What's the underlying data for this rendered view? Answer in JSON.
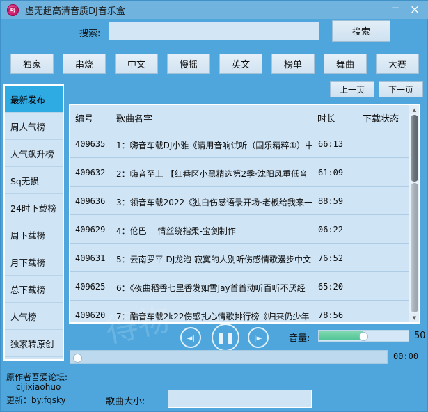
{
  "window": {
    "title": "虚无超高清音质DJ音乐盒",
    "icon": "dj-headphone-icon",
    "icon_text": "DJ",
    "minimize": "−",
    "close": "×"
  },
  "search": {
    "label": "搜索:",
    "value": "",
    "placeholder": "",
    "button": "搜索"
  },
  "categories": [
    {
      "label": "独家"
    },
    {
      "label": "串烧"
    },
    {
      "label": "中文"
    },
    {
      "label": "慢摇"
    },
    {
      "label": "英文"
    },
    {
      "label": "榜单"
    },
    {
      "label": "舞曲"
    },
    {
      "label": "大赛"
    }
  ],
  "pagination": {
    "prev": "上一页",
    "next": "下一页"
  },
  "sidebar": {
    "items": [
      {
        "label": "最新发布",
        "active": true
      },
      {
        "label": "周人气榜",
        "active": false
      },
      {
        "label": "人气飙升榜",
        "active": false
      },
      {
        "label": "Sq无损",
        "active": false
      },
      {
        "label": "24时下载榜",
        "active": false
      },
      {
        "label": "周下载榜",
        "active": false
      },
      {
        "label": "月下载榜",
        "active": false
      },
      {
        "label": "总下载榜",
        "active": false
      },
      {
        "label": "人气榜",
        "active": false
      },
      {
        "label": "独家转原创",
        "active": false
      }
    ]
  },
  "list": {
    "headers": {
      "id": "编号",
      "name": "歌曲名字",
      "duration": "时长",
      "status": "下载状态"
    },
    "rows": [
      {
        "id": "409635",
        "name": "1：嗨音车载DJ小雅《请用音响试听（国乐精粹①）中",
        "duration": "66:13",
        "status": ""
      },
      {
        "id": "409632",
        "name": "2：嗨音至上 【红番区小黑精选第2季·沈阳风重低音",
        "duration": "61:09",
        "status": ""
      },
      {
        "id": "409636",
        "name": "3：领音车载2022《独白伤感语录开场·老板给我来一",
        "duration": "88:59",
        "status": ""
      },
      {
        "id": "409629",
        "name": "4：伦巴　 情丝绕指柔-宝剑制作",
        "duration": "06:22",
        "status": ""
      },
      {
        "id": "409631",
        "name": "5：云南罗平 DJ龙泡 寂寞的人别听伤感情歌漫步中文",
        "duration": "76:52",
        "status": ""
      },
      {
        "id": "409625",
        "name": "6：《夜曲稻香七里香发如雪Jay首首动听百听不厌经",
        "duration": "65:20",
        "status": ""
      },
      {
        "id": "409620",
        "name": "7：酷音车载2k22伤感扎心情歌排行榜《归来仍少年-",
        "duration": "78:56",
        "status": ""
      }
    ]
  },
  "player": {
    "prev_icon": "◄|",
    "play_icon": "❚❚",
    "next_icon": "|►",
    "volume_label": "音量:",
    "volume_value": "50",
    "progress_time": "00:00"
  },
  "footer": {
    "line1": "原作者吾爱论坛:",
    "line2": "cijixiaohuo",
    "line3": "更新：by:fqsky",
    "size_label": "歌曲大小:",
    "size_value": "",
    "watermark": "得物"
  },
  "colors": {
    "window_bg": "#4ea6dc",
    "titlebar": "#6fb3de",
    "panel": "#cfe4f5",
    "accent_selected": "#2fabe4",
    "volume_fill": "#4fc394",
    "icon_pink": "#cf1f6e"
  }
}
